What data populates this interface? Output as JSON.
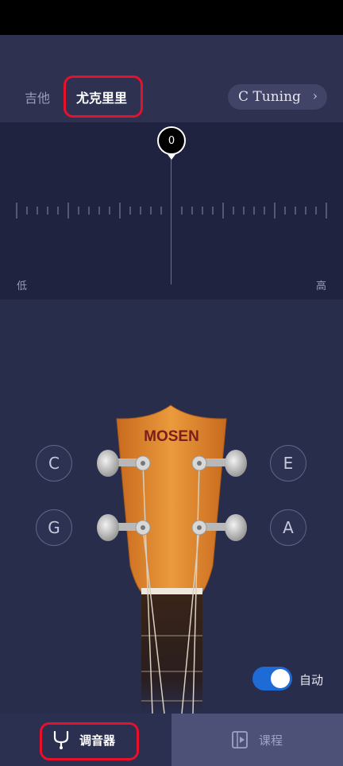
{
  "tabs": {
    "guitar": "吉他",
    "ukulele": "尤克里里"
  },
  "tuning": {
    "label": "C Tuning",
    "chevron": "›"
  },
  "meter": {
    "value": "0",
    "low_label": "低",
    "high_label": "高"
  },
  "strings": {
    "c": "C",
    "e": "E",
    "g": "G",
    "a": "A"
  },
  "brand": "MOSEN",
  "auto": {
    "label": "自动",
    "enabled": true
  },
  "nav": {
    "tuner": "调音器",
    "course": "课程"
  },
  "colors": {
    "accent": "#1f6bd6",
    "highlight": "#e8102a",
    "headstock": "#e0882e"
  }
}
